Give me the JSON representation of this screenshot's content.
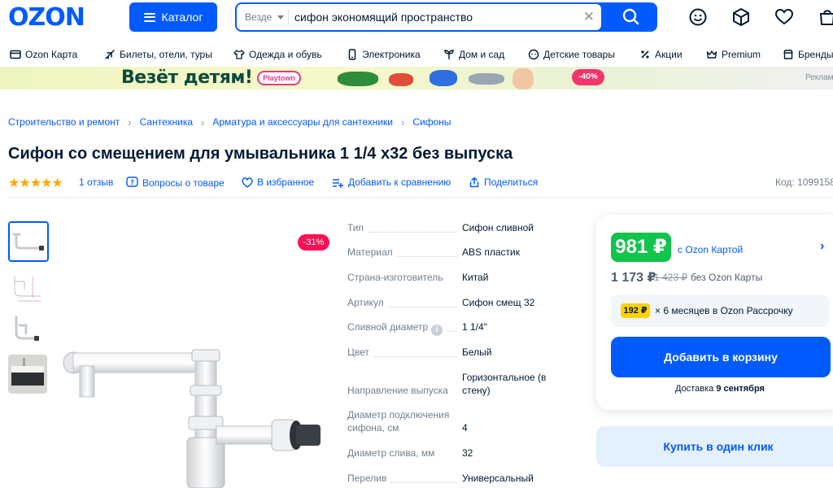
{
  "header": {
    "logo": "OZON",
    "catalog_label": "Каталог",
    "search": {
      "scope": "Везде",
      "query": "сифон экономящий пространство"
    }
  },
  "nav": {
    "items": [
      {
        "label": "Ozon Карта",
        "icon": "card-icon"
      },
      {
        "label": "Билеты, отели, туры",
        "icon": "plane-icon"
      },
      {
        "label": "Одежда и обувь",
        "icon": "clothes-icon"
      },
      {
        "label": "Электроника",
        "icon": "phone-icon"
      },
      {
        "label": "Дом и сад",
        "icon": "plant-icon"
      },
      {
        "label": "Детские товары",
        "icon": "kids-icon"
      },
      {
        "label": "Акции",
        "icon": "percent-icon"
      },
      {
        "label": "Premium",
        "icon": "crown-icon"
      },
      {
        "label": "Бренды",
        "icon": "store-icon"
      }
    ]
  },
  "banner": {
    "title": "Везёт детям!",
    "brand": "Playtown",
    "discount": "-40%",
    "ad_label": "Реклам"
  },
  "breadcrumb": [
    "Строительство и ремонт",
    "Сантехника",
    "Арматура и аксессуары для сантехники",
    "Сифоны"
  ],
  "product": {
    "title": "Сифон со смещением для умывальника 1 1/4 х32 без выпуска",
    "rating": 5,
    "reviews": "1 отзыв",
    "questions": "Вопросы о товаре",
    "favorite": "В избранное",
    "compare": "Добавить к сравнению",
    "share": "Поделиться",
    "code": "Код: 1099158",
    "discount": "-31%"
  },
  "specs": [
    {
      "label": "Тип",
      "value": "Сифон сливной"
    },
    {
      "label": "Материал",
      "value": "ABS пластик"
    },
    {
      "label": "Страна-изготовитель",
      "value": "Китай"
    },
    {
      "label": "Артикул",
      "value": "Сифон смещ 32"
    },
    {
      "label": "Сливной диаметр",
      "value": "1 1/4\""
    },
    {
      "label": "Цвет",
      "value": "Белый"
    },
    {
      "label": "Направление выпуска",
      "value": "Горизонтальное (в стену)"
    },
    {
      "label": "Диаметр подключения сифона, см",
      "value": "4"
    },
    {
      "label": "Диаметр слива, мм",
      "value": "32"
    },
    {
      "label": "Перелив",
      "value": "Универсальный"
    }
  ],
  "price": {
    "card_price": "981 ₽",
    "card_label": "с Ozon Картой",
    "regular": "1 173 ₽",
    "old": "1 423 ₽",
    "no_card": "без Ozon Карты",
    "installment_amount": "192 ₽",
    "installment_text": "× 6 месяцев в Ozon Рассрочку",
    "add_to_cart": "Добавить в корзину",
    "delivery_prefix": "Доставка",
    "delivery_date": "9 сентября",
    "buy_one_click": "Купить в один клик"
  },
  "colors": {
    "brand": "#005bff",
    "price_green": "#10c44c",
    "discount_red": "#f91155"
  }
}
